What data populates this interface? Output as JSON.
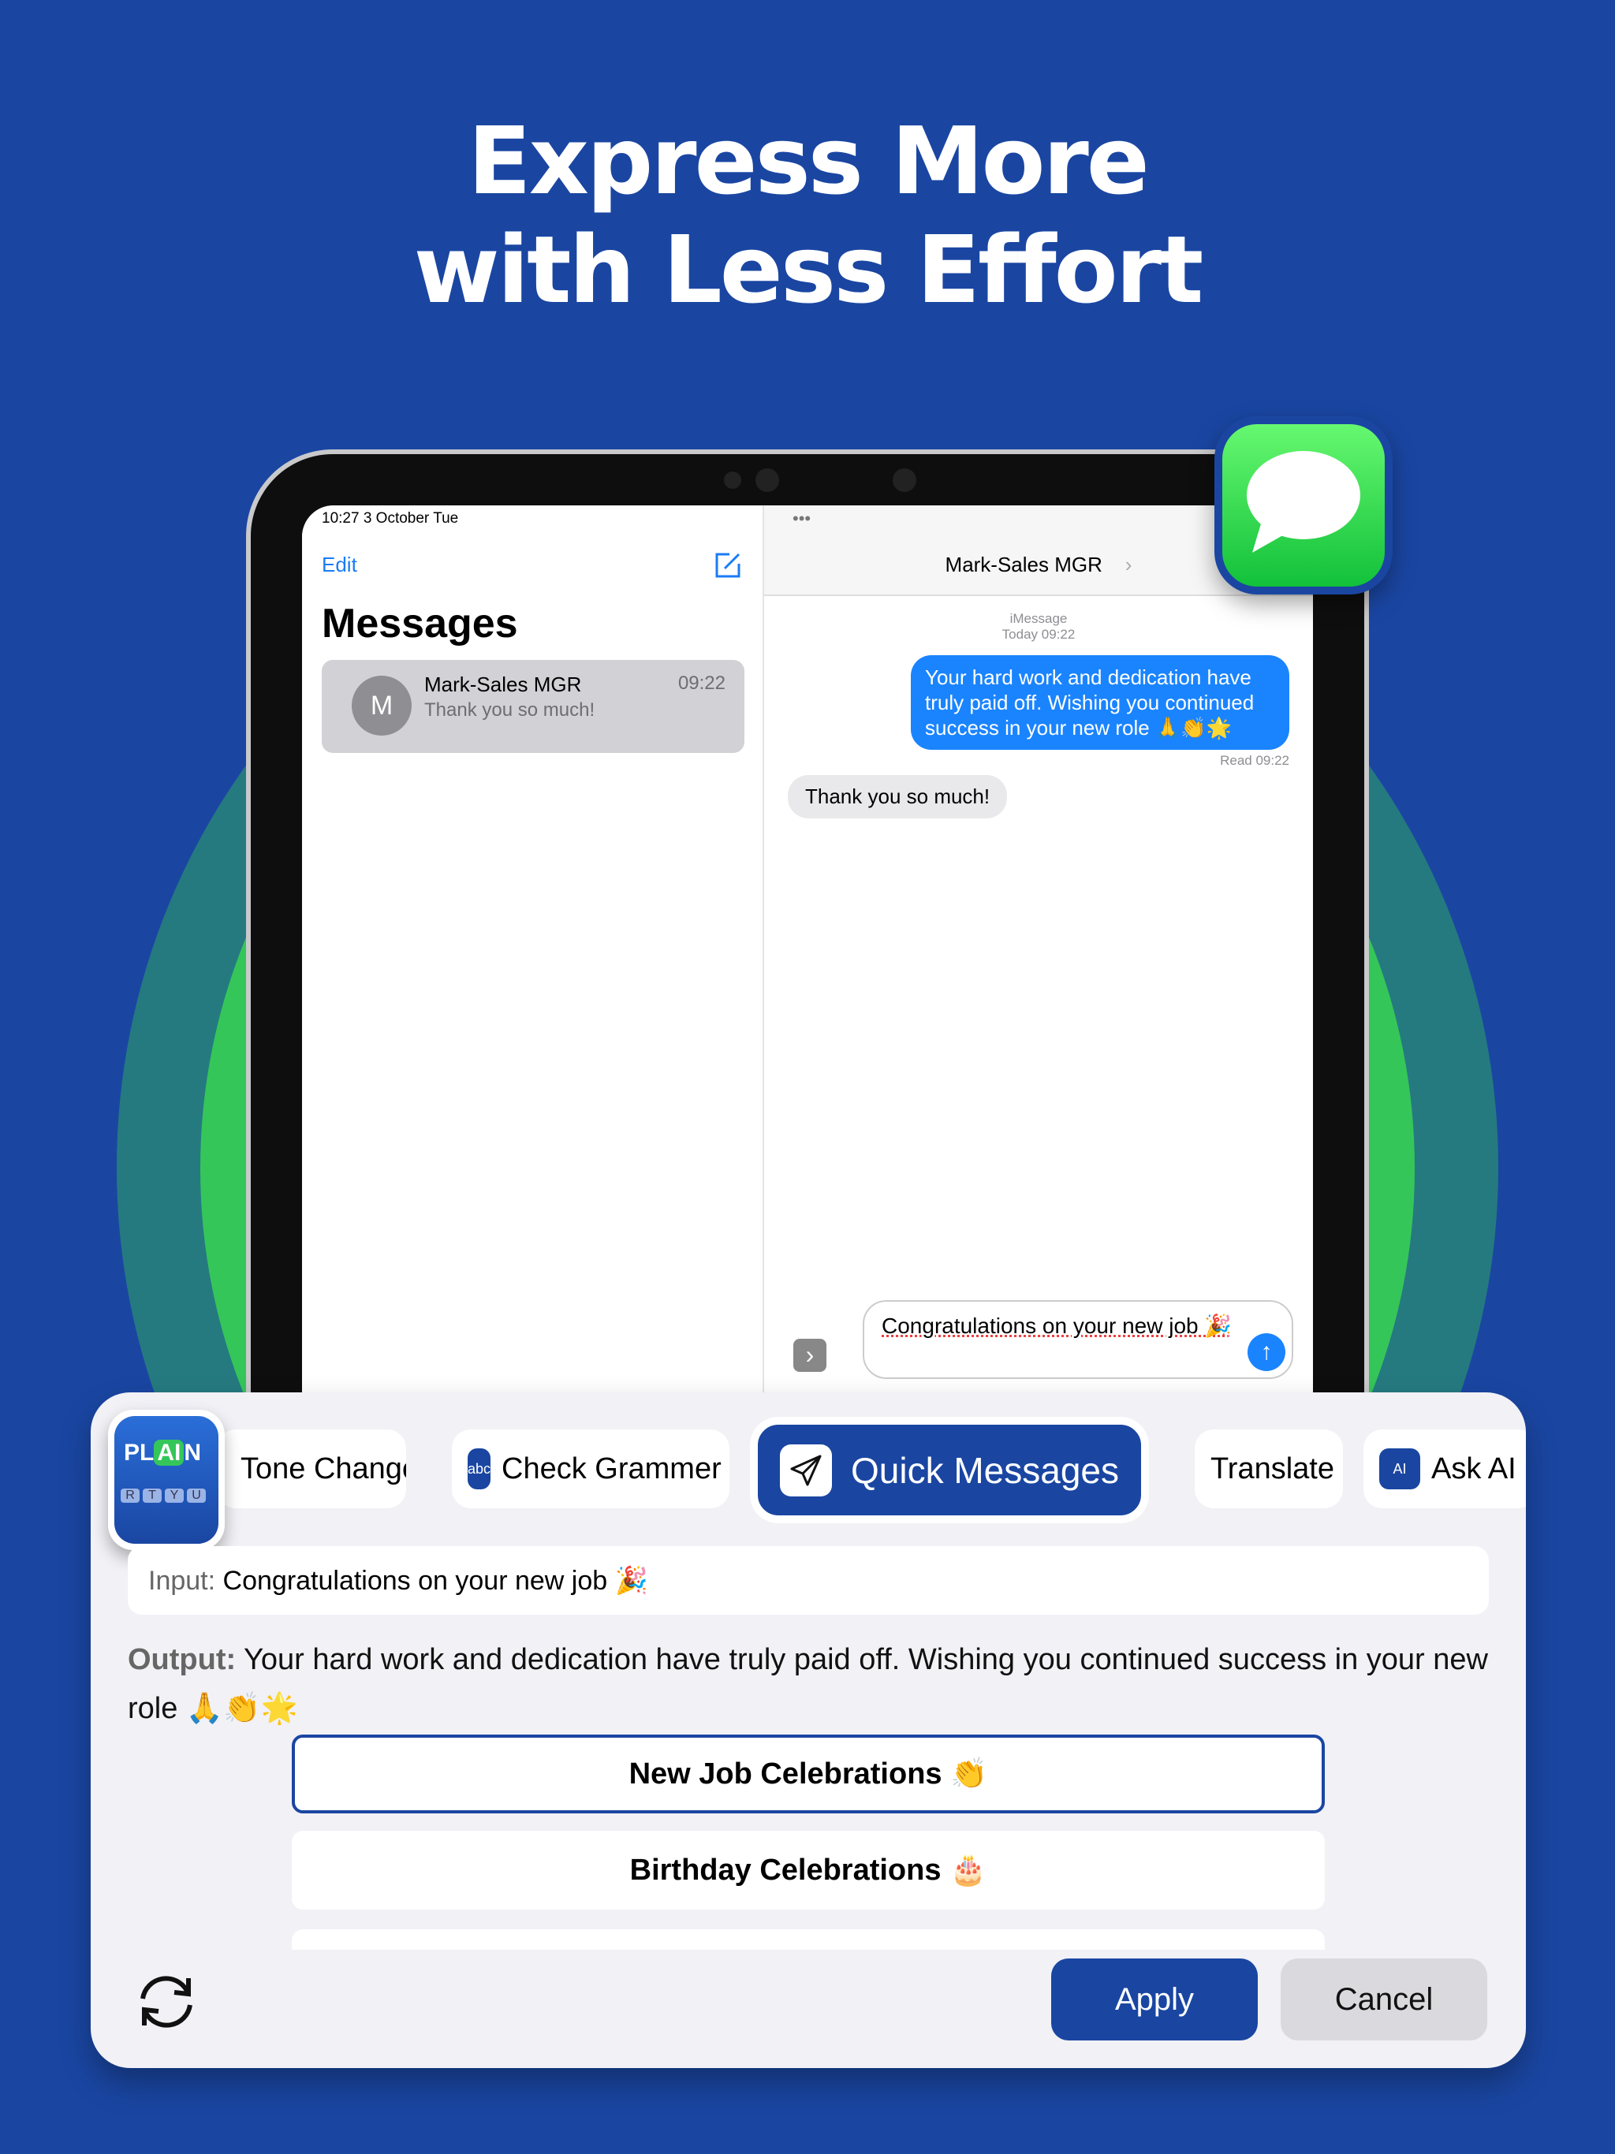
{
  "headline": {
    "line1": "Express More",
    "line2": "with Less Effort"
  },
  "colors": {
    "background": "#1a46a2",
    "accent": "#1a46a2",
    "imessage_blue": "#1a84ff",
    "green": "#35c65a"
  },
  "ipad": {
    "status_bar": "10:27   3 October Tue",
    "sidebar": {
      "edit_label": "Edit",
      "compose_icon": "compose-icon",
      "title": "Messages",
      "conversation": {
        "avatar_initial": "M",
        "name": "Mark-Sales MGR",
        "preview": "Thank you so much!",
        "time": "09:22"
      }
    },
    "chat": {
      "more_dots": "•••",
      "contact": "Mark-Sales MGR",
      "chevron": "›",
      "service": "iMessage",
      "timestamp": "Today 09:22",
      "outgoing": "Your hard work and dedication have truly paid off. Wishing you continued success in your new role 🙏👏🌟",
      "read_receipt": "Read 09:22",
      "incoming": "Thank you so much!",
      "compose_text": "Congratulations on your new job 🎉",
      "expand_icon": "›"
    }
  },
  "keyboard": {
    "logo_text": {
      "left": "PL",
      "ai": "AI",
      "right": "N",
      "keys": [
        "R",
        "T",
        "Y",
        "U"
      ]
    },
    "tabs": [
      {
        "label": "Tone Changer"
      },
      {
        "label": "Check Grammer",
        "icon": "abc"
      },
      {
        "label": "Quick Messages"
      },
      {
        "label": "Translate"
      },
      {
        "label": "Ask AI",
        "icon": "AI"
      }
    ],
    "input_label": "Input:",
    "input_value": "Congratulations on your new job 🎉",
    "output_label": "Output:",
    "output_value": "Your hard work and dedication have truly paid off. Wishing you continued success in your new role 🙏👏🌟",
    "options": [
      {
        "label": "New Job Celebrations 👏",
        "selected": true
      },
      {
        "label": "Birthday Celebrations 🎂",
        "selected": false
      }
    ],
    "apply_label": "Apply",
    "cancel_label": "Cancel"
  }
}
